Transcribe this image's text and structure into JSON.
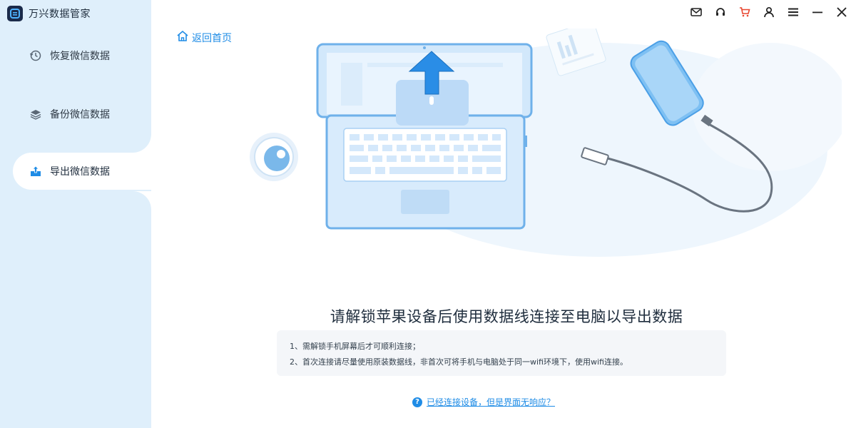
{
  "app": {
    "title": "万兴数据管家",
    "accent_color": "#1f8ce6"
  },
  "sidebar": {
    "items": [
      {
        "label": "恢复微信数据",
        "icon": "restore-clock-icon",
        "active": false
      },
      {
        "label": "备份微信数据",
        "icon": "layers-icon",
        "active": false
      },
      {
        "label": "导出微信数据",
        "icon": "export-upload-icon",
        "active": true
      }
    ]
  },
  "titlebar": {
    "icons": [
      "mail-icon",
      "headset-icon",
      "cart-icon",
      "user-icon",
      "menu-icon",
      "minimize-icon",
      "close-icon"
    ]
  },
  "main": {
    "back_label": "返回首页",
    "heading": "请解锁苹果设备后使用数据线连接至电脑以导出数据",
    "tips": [
      "1、需解锁手机屏幕后才可顺利连接；",
      "2、首次连接请尽量使用原装数据线，非首次可将手机与电脑处于同一wifi环境下，使用wifi连接。"
    ],
    "help_link": "已经连接设备，但是界面无响应？"
  }
}
